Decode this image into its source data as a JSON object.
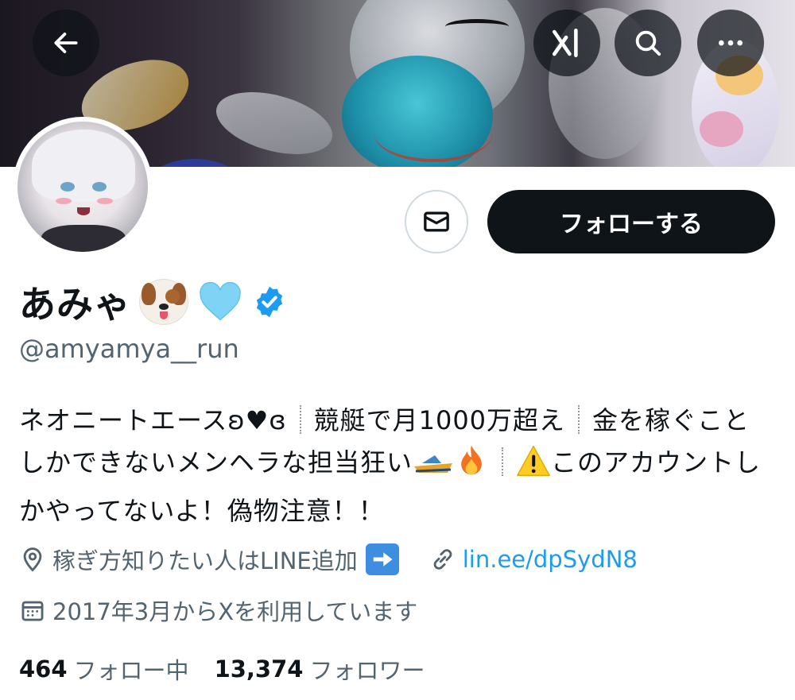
{
  "header": {
    "back_icon": "arrow-left-icon",
    "grok_icon": "grok-icon",
    "search_icon": "search-icon",
    "more_icon": "more-horizontal-icon"
  },
  "profile": {
    "display_name": "あみゃ",
    "name_emojis": [
      "dog-face-emoji",
      "light-blue-heart-emoji"
    ],
    "verified_badge": "verified-badge-icon",
    "handle": "@amyamya__run",
    "follow_label": "フォローする",
    "message_icon": "envelope-icon"
  },
  "bio": {
    "line1_a": "ネオニートエースʚ♥ɞ",
    "line1_b": "競艇で月1000万超え",
    "line1_c": "金を稼",
    "line2_a": "ぐことしかできないメンヘラな担当狂い",
    "line2_c": "このアカウントしかやってないよ！偽物注意！！",
    "emojis": [
      "speedboat-emoji",
      "fire-emoji",
      "warning-emoji"
    ]
  },
  "meta": {
    "location": "稼ぎ方知りたい人はLINE追加",
    "location_icon": "location-pin-icon",
    "location_emoji": "right-arrow-emoji",
    "link_icon": "link-icon",
    "link": "lin.ee/dpSydN8",
    "joined": "2017年3月からXを利用しています",
    "joined_icon": "calendar-icon"
  },
  "stats": {
    "following_count": "464",
    "following_label": "フォロー中",
    "followers_count": "13,374",
    "followers_label": "フォロワー"
  },
  "colors": {
    "accent": "#1d9bf0",
    "text_primary": "#0f1419",
    "text_secondary": "#536471",
    "button_dark": "#0f1419"
  }
}
